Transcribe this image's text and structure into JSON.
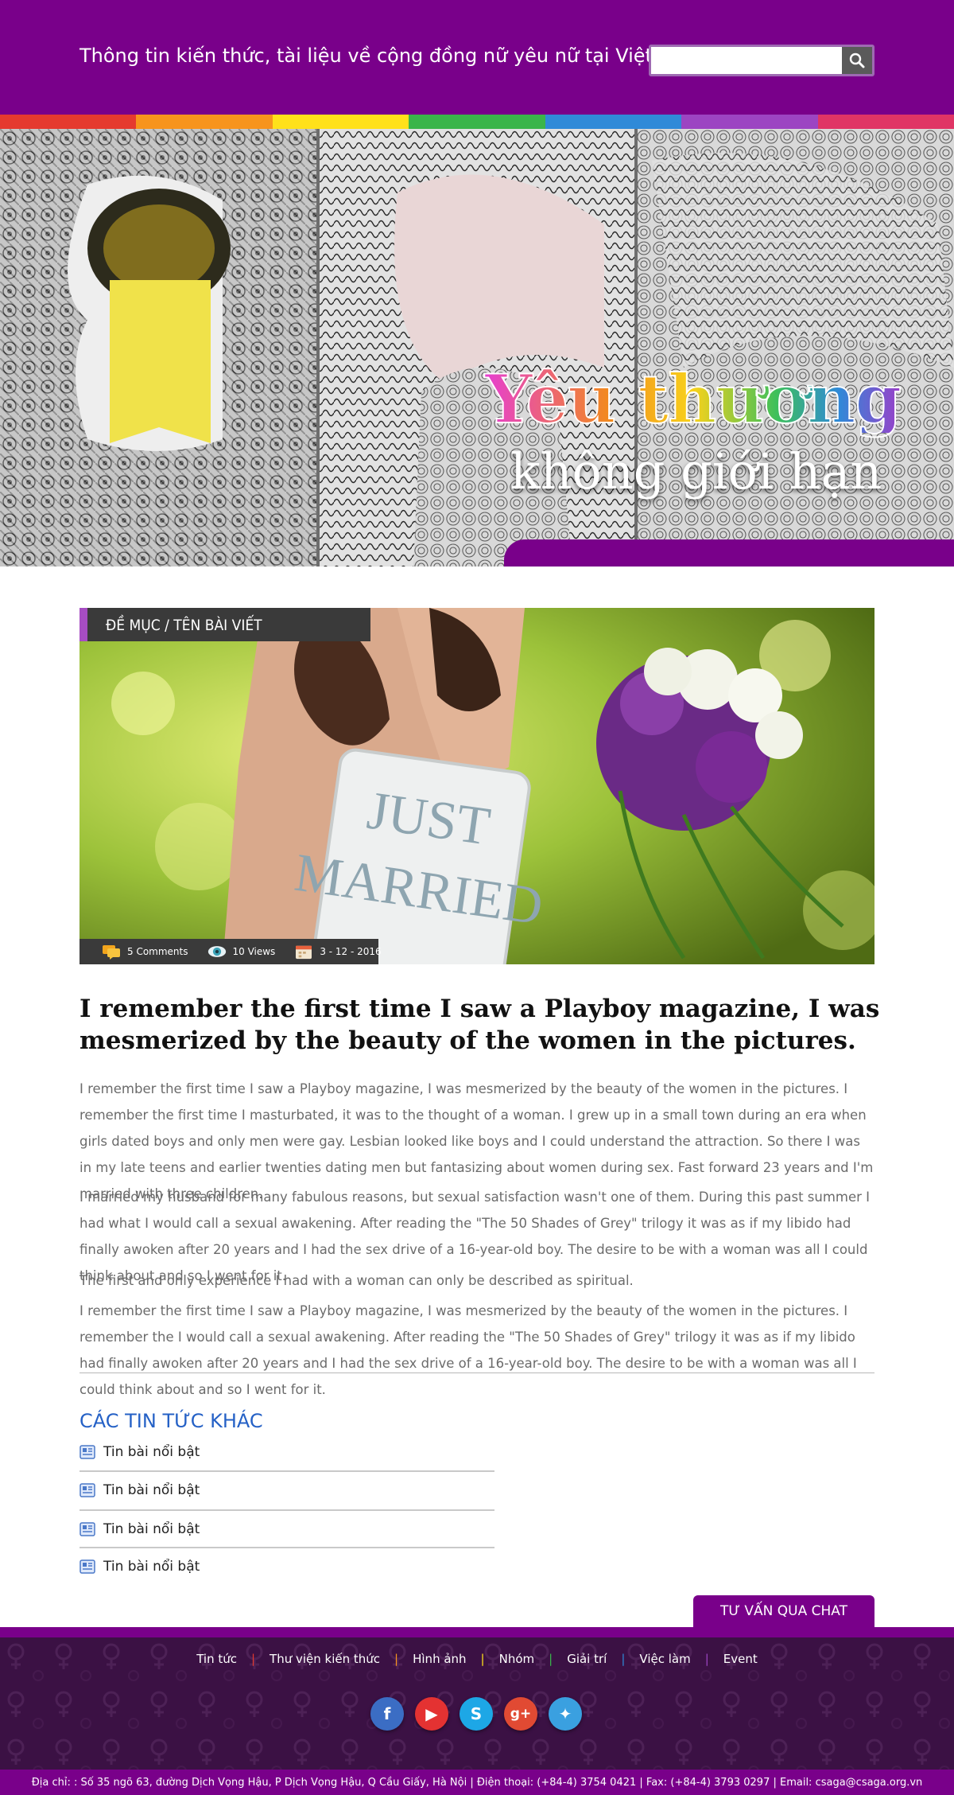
{
  "header": {
    "tagline": "Thông tin kiến thức, tài liệu về cộng đồng nữ yêu nữ tại Việt Nam",
    "search_placeholder": "",
    "search_icon": "search-icon"
  },
  "rainbow_colors": [
    "#e53a2f",
    "#f7941d",
    "#ffe11a",
    "#3ab54a",
    "#2f8ad8",
    "#9c45c2",
    "#e03565"
  ],
  "banner": {
    "title_line1": "Yêu thương",
    "title_line2": "không giới hạn"
  },
  "article": {
    "breadcrumb": "ĐỀ MỤC / TÊN BÀI VIẾT",
    "image_sign_text": [
      "JUST",
      "MARRIED"
    ],
    "meta": {
      "comments": "5 Comments",
      "views": "10 Views",
      "date": "3 - 12 - 2016"
    },
    "headline": "I remember the first time I saw a Playboy magazine, I was mesmerized by the beauty of the women in the pictures.",
    "paragraphs": [
      "I remember the first time I saw a Playboy magazine, I was mesmerized by the beauty of the women in the pictures. I remember the first time I masturbated, it was to the thought of a woman. I grew up in a small town during an era when girls dated boys and only men were gay. Lesbian looked like boys and I could understand the attraction. So there I was in my late teens and earlier twenties dating men but fantasizing about women during sex. Fast forward 23 years and I'm married with three children.",
      "I married my husband for many fabulous reasons, but sexual satisfaction wasn't one of them. During this past summer I had what I would call a sexual awakening. After reading the \"The 50 Shades of Grey\" trilogy it was as if my libido had finally awoken after 20 years and I had the sex drive of a 16-year-old boy. The desire to be with a woman was all I could think about and so I went for it.",
      "The first and only experience I had with a woman can only be described as spiritual.",
      "I remember the first time I saw a Playboy magazine, I was mesmerized by the beauty of the women in the pictures. I remember the I would call a sexual awakening. After reading the \"The 50 Shades of Grey\" trilogy it was as if my libido had finally awoken after 20 years and I had the sex drive of a 16-year-old boy. The desire to be with a woman was all I could think about and so I went for it."
    ]
  },
  "other_news": {
    "title": "CÁC TIN TỨC KHÁC",
    "items": [
      "Tin bài nổi bật",
      "Tin bài nổi bật",
      "Tin bài nổi bật",
      "Tin bài nổi bật"
    ]
  },
  "chat_button": "TƯ VẤN QUA CHAT",
  "footer": {
    "nav": [
      "Tin tức",
      "Thư viện kiến thức",
      "Hình ảnh",
      "Nhóm",
      "Giải trí",
      "Việc làm",
      "Event"
    ],
    "nav_separator_colors": [
      "#e53a2f",
      "#f7941d",
      "#ffe11a",
      "#3ab54a",
      "#2f8ad8",
      "#9c45c2"
    ],
    "social": [
      {
        "icon": "facebook-icon",
        "color": "#3b6dc4"
      },
      {
        "icon": "youtube-icon",
        "color": "#e43232"
      },
      {
        "icon": "skype-icon",
        "color": "#1da7e6"
      },
      {
        "icon": "google-plus-icon",
        "color": "#e14a33"
      },
      {
        "icon": "twitter-icon",
        "color": "#3aa0e0"
      }
    ],
    "address": "Địa chỉ: : Số 35 ngõ 63, đường Dịch Vọng Hậu, P Dịch Vọng Hậu, Q Cầu Giấy, Hà Nội  |  Điện thoại: (+84-4) 3754 0421  |  Fax: (+84-4) 3793 0297  |  Email: csaga@csaga.org.vn"
  },
  "colors": {
    "brand_purple": "#79008a",
    "link_blue": "#2561c6",
    "footer_bg": "#3b1144"
  }
}
